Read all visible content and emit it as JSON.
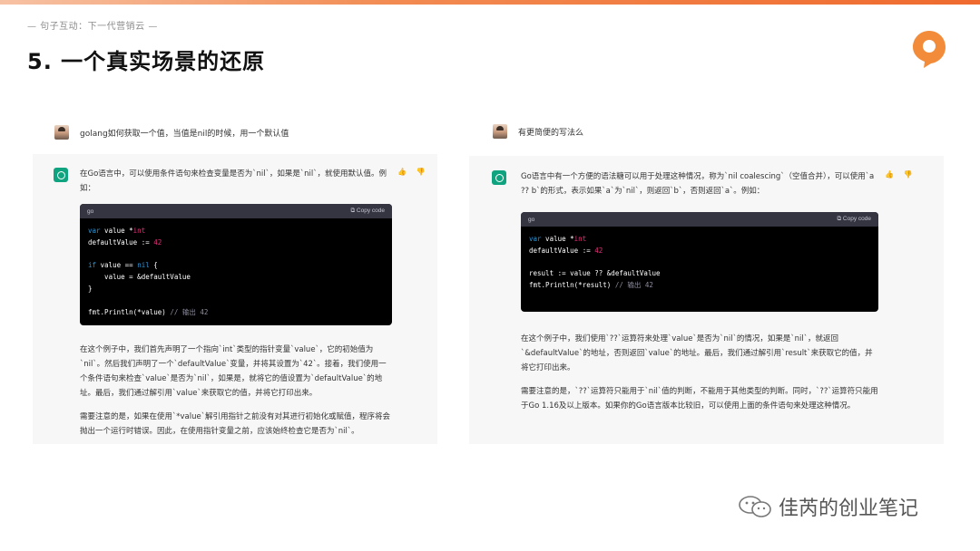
{
  "header": {
    "tagline": "— 句子互动：下一代营销云 —",
    "title": "5. 一个真实场景的还原"
  },
  "colors": {
    "accent": "#ef6a2e",
    "chatgpt_green": "#10a37f",
    "code_bg": "#000000",
    "code_header": "#343541"
  },
  "left": {
    "question": "golang如何获取一个值，当值是nil的时候，用一个默认值",
    "intro": "在Go语言中，可以使用条件语句来检查变量是否为`nil`，如果是`nil`，就使用默认值。例如：",
    "code_lang": "go",
    "copy_label": "Copy code",
    "code": {
      "l1a": "var",
      "l1b": " value *",
      "l1c": "int",
      "l2a": "defaultValue := ",
      "l2b": "42",
      "l3a": "if",
      "l3b": " value == ",
      "l3c": "nil",
      "l3d": " {",
      "l4": "    value = &defaultValue",
      "l5": "}",
      "l6a": "fmt.Println(*value) ",
      "l6b": "// 输出 42"
    },
    "para1": "在这个例子中，我们首先声明了一个指向`int`类型的指针变量`value`，它的初始值为`nil`。然后我们声明了一个`defaultValue`变量，并将其设置为`42`。接着，我们使用一个条件语句来检查`value`是否为`nil`，如果是，就将它的值设置为`defaultValue`的地址。最后，我们通过解引用`value`来获取它的值，并将它打印出来。",
    "para2": "需要注意的是，如果在使用`*value`解引用指针之前没有对其进行初始化或赋值，程序将会抛出一个运行时错误。因此，在使用指针变量之前，应该始终检查它是否为`nil`。"
  },
  "right": {
    "question": "有更简便的写法么",
    "intro": "Go语言中有一个方便的语法糖可以用于处理这种情况，称为`nil coalescing`（空值合并），可以使用`a ?? b`的形式，表示如果`a`为`nil`，则返回`b`，否则返回`a`。例如：",
    "code_lang": "go",
    "copy_label": "Copy code",
    "code": {
      "l1a": "var",
      "l1b": " value *",
      "l1c": "int",
      "l2a": "defaultValue := ",
      "l2b": "42",
      "l3": "result := value ?? &defaultValue",
      "l4a": "fmt.Println(*result) ",
      "l4b": "// 输出 42"
    },
    "para1": "在这个例子中，我们使用`??`运算符来处理`value`是否为`nil`的情况，如果是`nil`，就返回`&defaultValue`的地址，否则返回`value`的地址。最后，我们通过解引用`result`来获取它的值，并将它打印出来。",
    "para2": "需要注意的是，`??`运算符只能用于`nil`值的判断，不能用于其他类型的判断。同时，`??`运算符只能用于Go 1.16及以上版本。如果你的Go语言版本比较旧，可以使用上面的条件语句来处理这种情况。"
  },
  "thumbs": "👍 👎",
  "watermark": {
    "text": "佳芮的创业笔记",
    "icon": "wechat-icon"
  }
}
